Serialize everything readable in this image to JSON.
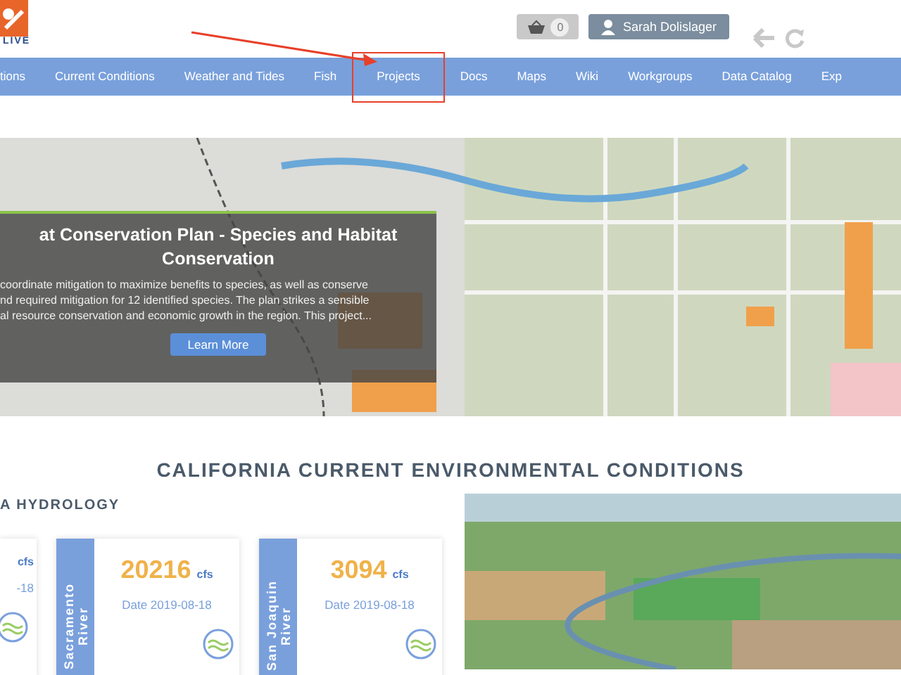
{
  "logo": {
    "text": "LIVE"
  },
  "cart": {
    "count": "0"
  },
  "user": {
    "name": "Sarah Dolislager"
  },
  "nav": [
    {
      "label": "tions",
      "highlighted": false
    },
    {
      "label": "Current Conditions",
      "highlighted": false
    },
    {
      "label": "Weather and Tides",
      "highlighted": false
    },
    {
      "label": "Fish",
      "highlighted": false
    },
    {
      "label": "Projects",
      "highlighted": true
    },
    {
      "label": "Docs",
      "highlighted": false
    },
    {
      "label": "Maps",
      "highlighted": false
    },
    {
      "label": "Wiki",
      "highlighted": false
    },
    {
      "label": "Workgroups",
      "highlighted": false
    },
    {
      "label": "Data Catalog",
      "highlighted": false
    },
    {
      "label": "Exp",
      "highlighted": false
    }
  ],
  "hero": {
    "title_lines": [
      "at Conservation Plan - Species and Habitat",
      "Conservation"
    ],
    "description_lines": [
      "coordinate mitigation to maximize benefits to species, as well as conserve",
      "nd required mitigation for 12 identified species. The plan strikes a sensible",
      "al resource conservation and economic growth in the region. This project..."
    ],
    "button": "Learn More"
  },
  "conditions": {
    "heading": "CALIFORNIA CURRENT ENVIRONMENTAL CONDITIONS",
    "subheading": "A HYDROLOGY",
    "cards": [
      {
        "unit": "cfs",
        "date": "-18"
      },
      {
        "name": "Sacramento River",
        "value": "20216",
        "unit": "cfs",
        "date": "Date 2019-08-18"
      },
      {
        "name": "San Joaquin River",
        "value": "3094",
        "unit": "cfs",
        "date": "Date 2019-08-18"
      }
    ]
  }
}
